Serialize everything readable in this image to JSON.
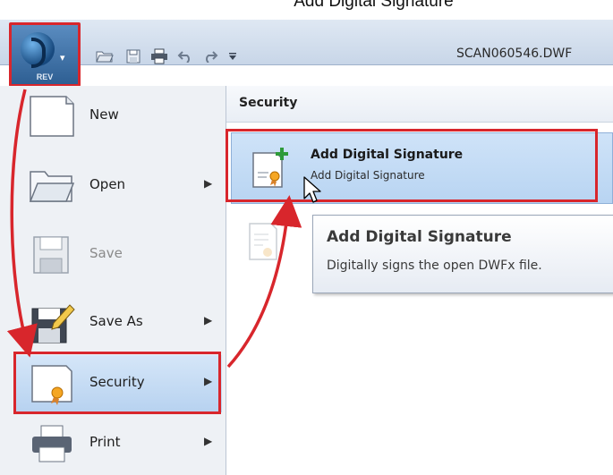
{
  "caption": "Add Digital Signature ",
  "app": {
    "badge": "REV",
    "filename": "SCAN060546.DWF"
  },
  "menu": {
    "items": [
      {
        "label": "New",
        "has_submenu": false,
        "enabled": true
      },
      {
        "label": "Open",
        "has_submenu": true,
        "enabled": true
      },
      {
        "label": "Save",
        "has_submenu": false,
        "enabled": false
      },
      {
        "label": "Save As",
        "has_submenu": true,
        "enabled": true
      },
      {
        "label": "Security",
        "has_submenu": true,
        "enabled": true,
        "selected": true
      },
      {
        "label": "Print",
        "has_submenu": true,
        "enabled": true
      }
    ]
  },
  "security_panel": {
    "header": "Security",
    "add_signature": {
      "title": "Add Digital Signature",
      "subtitle": "Add Digital Signature"
    }
  },
  "tooltip": {
    "title": "Add Digital Signature",
    "description": "Digitally signs the open DWFx file."
  },
  "colors": {
    "highlight_border": "#d8262c",
    "selection": "#b8d4f2",
    "titlebar": "#c8d6e8"
  }
}
